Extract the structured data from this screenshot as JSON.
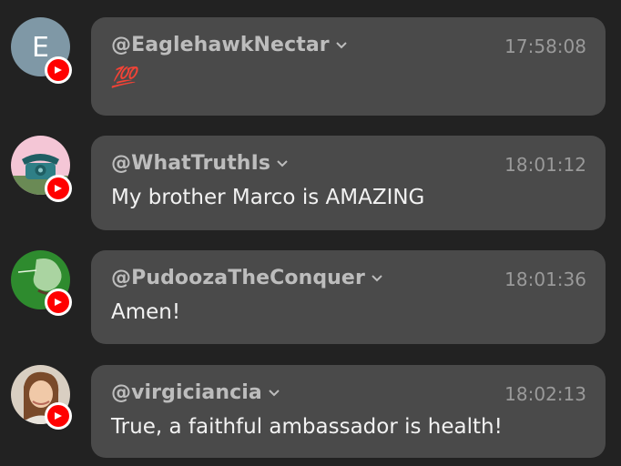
{
  "messages": [
    {
      "username": "@EaglehawkNectar",
      "time": "17:58:08",
      "text": "",
      "emoji": "💯",
      "avatar": {
        "type": "letter",
        "letter": "E",
        "bg": "#7f98a6"
      },
      "source_icon": "youtube-icon"
    },
    {
      "username": "@WhatTruthIs",
      "time": "18:01:12",
      "text": "My brother Marco is AMAZING",
      "avatar": {
        "type": "image",
        "depicts": "telephone",
        "bg": "#f4c6d6"
      },
      "source_icon": "youtube-icon"
    },
    {
      "username": "@PudoozaTheConquer",
      "time": "18:01:36",
      "text": "Amen!",
      "avatar": {
        "type": "image",
        "depicts": "green-sketch",
        "bg": "#2e8b2e"
      },
      "source_icon": "youtube-icon"
    },
    {
      "username": "@virgiciancia",
      "time": "18:02:13",
      "text": "True, a faithful ambassador is health!",
      "avatar": {
        "type": "image",
        "depicts": "portrait",
        "bg": "#d9cfc2"
      },
      "source_icon": "youtube-icon"
    }
  ],
  "colors": {
    "background": "#222222",
    "bubble": "#4a4a4a",
    "username": "#bdbdbd",
    "time": "#9a9a9a",
    "text": "#f2f2f2",
    "youtube_red": "#ff0000"
  }
}
